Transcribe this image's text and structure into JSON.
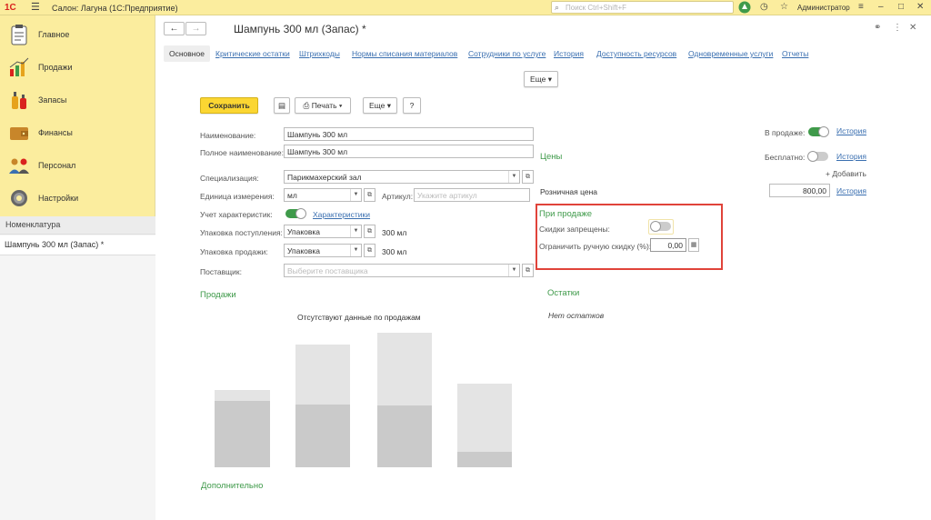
{
  "topbar": {
    "logo": "1С",
    "app_title": "Салон: Лагуна  (1С:Предприятие)",
    "search_placeholder": "Поиск Ctrl+Shift+F",
    "user": "Администратор"
  },
  "sidebar": {
    "items": [
      {
        "label": "Главное",
        "icon": "clipboard-icon"
      },
      {
        "label": "Продажи",
        "icon": "sales-chart-icon"
      },
      {
        "label": "Запасы",
        "icon": "bottles-icon"
      },
      {
        "label": "Финансы",
        "icon": "wallet-icon"
      },
      {
        "label": "Персонал",
        "icon": "people-icon"
      },
      {
        "label": "Настройки",
        "icon": "gear-icon"
      }
    ],
    "nav_header": "Номенклатура",
    "open_doc": "Шампунь 300 мл (Запас) *"
  },
  "form": {
    "title": "Шампунь 300 мл (Запас) *",
    "tabs": [
      "Основное",
      "Критические остатки",
      "Штрихкоды",
      "Нормы списания материалов",
      "Сотрудники по услуге",
      "История",
      "Доступность ресурсов",
      "Одновременные услуги",
      "Отчеты"
    ],
    "more_label": "Еще",
    "toolbar": {
      "save": "Сохранить",
      "print": "Печать",
      "more": "Еще",
      "help": "?"
    },
    "fields": {
      "name_label": "Наименование:",
      "name_value": "Шампунь 300 мл",
      "fullname_label": "Полное наименование:",
      "fullname_value": "Шампунь 300 мл",
      "spec_label": "Специализация:",
      "spec_value": "Парикмахерский зал",
      "unit_label": "Единица измерения:",
      "unit_value": "мл",
      "article_label": "Артикул:",
      "article_placeholder": "Укажите артикул",
      "char_label": "Учет характеристик:",
      "char_link": "Характеристики",
      "pack_in_label": "Упаковка поступления:",
      "pack_in_value": "Упаковка",
      "pack_in_qty": "300 мл",
      "pack_sale_label": "Упаковка продажи:",
      "pack_sale_value": "Упаковка",
      "pack_sale_qty": "300 мл",
      "supplier_label": "Поставщик:",
      "supplier_placeholder": "Выберите поставщика"
    },
    "right": {
      "on_sale_label": "В продаже:",
      "history": "История",
      "free_label": "Бесплатно:",
      "prices_header": "Цены",
      "add_label": "+ Добавить",
      "retail_label": "Розничная цена",
      "retail_value": "800,00",
      "on_sale_header": "При продаже",
      "discounts_label": "Скидки запрещены:",
      "limit_label": "Ограничить ручную скидку (%):",
      "limit_value": "0,00"
    },
    "sales_header": "Продажи",
    "no_sales": "Отсутствуют данные по продажам",
    "stock_header": "Остатки",
    "no_stock": "Нет остатков",
    "extra_header": "Дополнительно"
  },
  "colors": {
    "accent_yellow": "#fbd632",
    "panel_yellow": "#fbed9e",
    "green": "#3f9a4a",
    "link": "#3a6fb0",
    "highlight_red": "#e0433a"
  }
}
